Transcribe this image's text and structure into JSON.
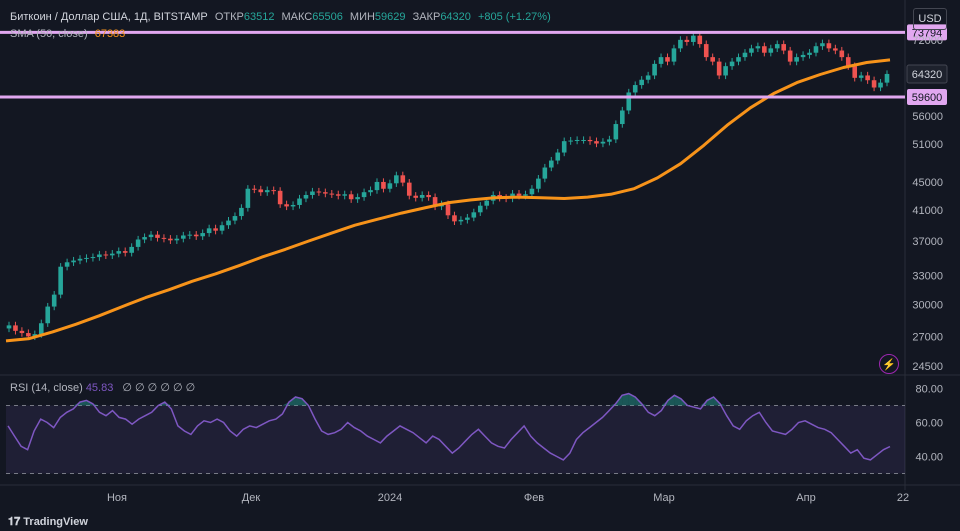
{
  "legend": {
    "symbol": "Биткоин / Доллар США, 1Д, BITSTAMP",
    "open_label": "ОТКР",
    "open": "63512",
    "high_label": "МАКС",
    "high": "65506",
    "low_label": "МИН",
    "low": "59629",
    "close_label": "ЗАКР",
    "close": "64320",
    "change": "+805 (+1.27%)",
    "sma_label": "SMA (50, close)",
    "sma_value": "67383"
  },
  "rsi_legend": {
    "label": "RSI (14, close)",
    "value": "45.83",
    "extras": "∅ ∅ ∅ ∅ ∅ ∅"
  },
  "currency_button": "USD",
  "brand": "TradingView",
  "colors": {
    "up": "#26a69a",
    "down": "#ef5350",
    "sma": "#f7931a",
    "rsi": "#7e57c2",
    "hline": "#e1a7f0",
    "bg": "#131722"
  },
  "chart_data": [
    {
      "type": "candlestick",
      "scale": "log",
      "ylim": [
        24000,
        80000
      ],
      "y_ticks": [
        "72000",
        "64320",
        "59600",
        "56000",
        "51000",
        "45000",
        "41000",
        "37000",
        "33000",
        "30000",
        "27000",
        "24500"
      ],
      "x_ticks": [
        "Ноя",
        "Дек",
        "2024",
        "Фев",
        "Мар",
        "Апр",
        "22"
      ],
      "horizontal_lines": [
        {
          "label": "73794",
          "value": 73794
        },
        {
          "label": "59600",
          "value": 59600
        }
      ],
      "price_label": "64320",
      "series": [
        {
          "name": "Price (close)",
          "values": [
            28000,
            27500,
            27300,
            27000,
            27200,
            28200,
            29800,
            31000,
            34000,
            34500,
            34700,
            34900,
            35000,
            35100,
            35400,
            35300,
            35500,
            35800,
            35600,
            36300,
            37200,
            37500,
            37800,
            37400,
            37300,
            37100,
            37300,
            37700,
            37800,
            37600,
            38000,
            38600,
            38300,
            39000,
            39600,
            40200,
            41300,
            44000,
            43900,
            43500,
            43800,
            43700,
            41800,
            41500,
            41700,
            42600,
            43100,
            43600,
            43500,
            43300,
            43200,
            43000,
            43200,
            42500,
            42800,
            43500,
            43800,
            45000,
            44000,
            44800,
            46000,
            44900,
            43000,
            42700,
            43100,
            42800,
            41500,
            41800,
            40300,
            39500,
            39700,
            40000,
            40700,
            41600,
            42300,
            43100,
            42700,
            42600,
            43300,
            43000,
            43200,
            44000,
            45500,
            47200,
            48300,
            49600,
            51500,
            51600,
            51700,
            51700,
            51500,
            51100,
            51400,
            51800,
            54500,
            57000,
            60500,
            62000,
            63100,
            64000,
            66500,
            68000,
            67000,
            70000,
            72000,
            71500,
            73000,
            71000,
            68000,
            67000,
            64000,
            66000,
            67000,
            68000,
            69000,
            70000,
            70500,
            69000,
            70000,
            71000,
            69500,
            67000,
            68000,
            68500,
            69000,
            70500,
            71200,
            70000,
            69500,
            68000,
            66000,
            63500,
            64000,
            63000,
            61500,
            62500,
            64320
          ]
        },
        {
          "name": "SMA (50, close)",
          "values": [
            26600,
            26800,
            27400,
            28100,
            28900,
            29800,
            30700,
            31500,
            32400,
            33200,
            34100,
            35100,
            36000,
            37000,
            38000,
            39000,
            39800,
            40600,
            41300,
            42000,
            42400,
            42700,
            42800,
            42700,
            42600,
            42800,
            43200,
            44000,
            45600,
            47800,
            50800,
            54300,
            57500,
            60300,
            62500,
            64200,
            65700,
            66800,
            67383
          ]
        }
      ]
    },
    {
      "type": "line",
      "title": "RSI (14, close)",
      "ylim": [
        25,
        85
      ],
      "y_ticks": [
        "80.00",
        "60.00",
        "40.00"
      ],
      "levels": [
        70,
        30
      ],
      "series": [
        {
          "name": "RSI",
          "values": [
            58,
            52,
            46,
            44,
            55,
            62,
            60,
            57,
            63,
            66,
            68,
            72,
            73,
            71,
            66,
            64,
            67,
            63,
            62,
            59,
            62,
            64,
            66,
            70,
            72,
            68,
            58,
            55,
            53,
            58,
            61,
            60,
            62,
            60,
            55,
            52,
            56,
            58,
            57,
            59,
            61,
            62,
            65,
            72,
            75,
            74,
            70,
            62,
            55,
            53,
            54,
            56,
            60,
            57,
            55,
            52,
            50,
            48,
            52,
            55,
            58,
            56,
            54,
            51,
            48,
            52,
            50,
            46,
            42,
            45,
            49,
            53,
            56,
            52,
            48,
            46,
            45,
            50,
            54,
            58,
            52,
            48,
            45,
            42,
            40,
            38,
            42,
            50,
            54,
            57,
            60,
            63,
            67,
            71,
            76,
            77,
            75,
            71,
            66,
            64,
            67,
            73,
            76,
            74,
            70,
            69,
            68,
            73,
            75,
            71,
            64,
            58,
            56,
            61,
            64,
            66,
            60,
            55,
            54,
            53,
            56,
            60,
            61,
            59,
            57,
            56,
            54,
            50,
            46,
            42,
            44,
            39,
            38,
            41,
            44,
            45.83
          ]
        }
      ]
    }
  ]
}
